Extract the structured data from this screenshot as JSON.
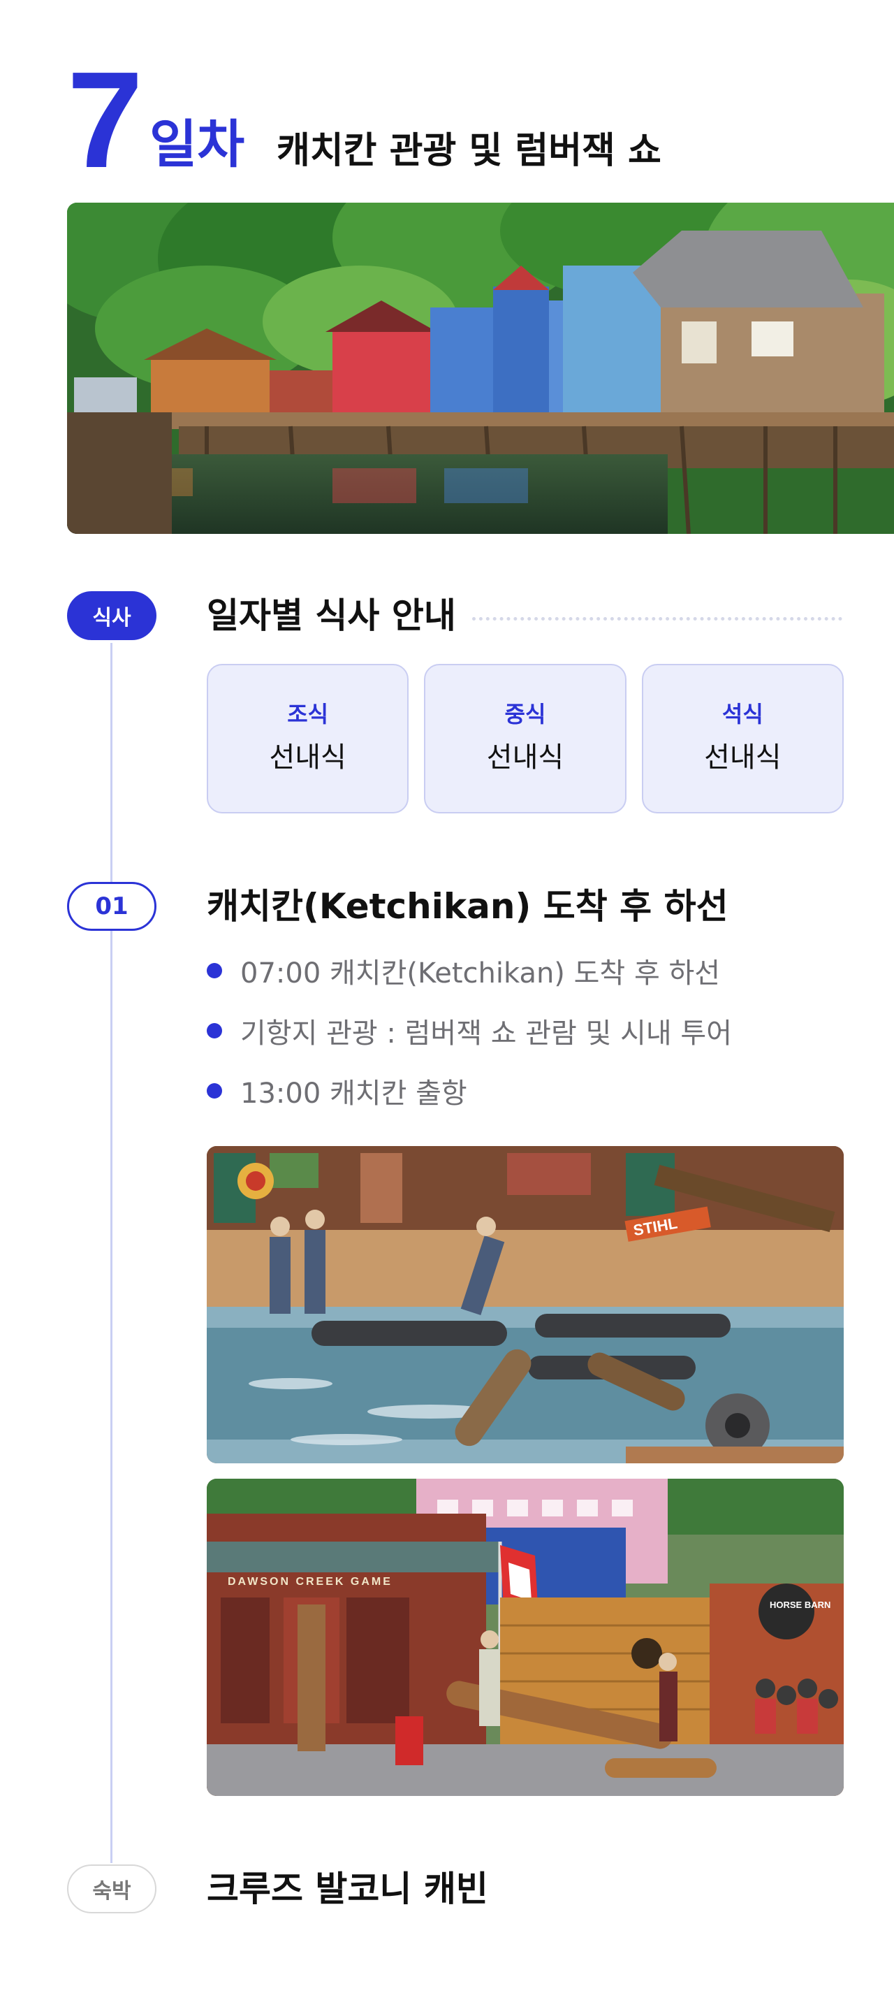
{
  "header": {
    "day_number": "7",
    "day_word": "일차",
    "title": "캐치칸 관광 및 럼버잭 쇼"
  },
  "meals": {
    "pill_label": "식사",
    "section_title": "일자별 식사 안내",
    "items": [
      {
        "label": "조식",
        "value": "선내식"
      },
      {
        "label": "중식",
        "value": "선내식"
      },
      {
        "label": "석식",
        "value": "선내식"
      }
    ]
  },
  "schedule": {
    "pill_label": "01",
    "title": "캐치칸(Ketchikan) 도착 후 하선",
    "bullets": [
      "07:00 캐치칸(Ketchikan) 도착 후 하선",
      "기항지 관광 : 럼버잭 쇼 관람 및 시내 투어",
      "13:00 캐치칸 출항"
    ]
  },
  "photos": {
    "stage_sign_1": "STIHL",
    "stage_sign_2": "DAWSON CREEK GAME",
    "stage_sign_3": "HORSE BARN"
  },
  "stay": {
    "pill_label": "숙박",
    "title": "크루즈 발코니 캐빈"
  },
  "colors": {
    "accent": "#2b33d6",
    "card_bg": "#eceefc",
    "bullet_text": "#6e6e73"
  }
}
